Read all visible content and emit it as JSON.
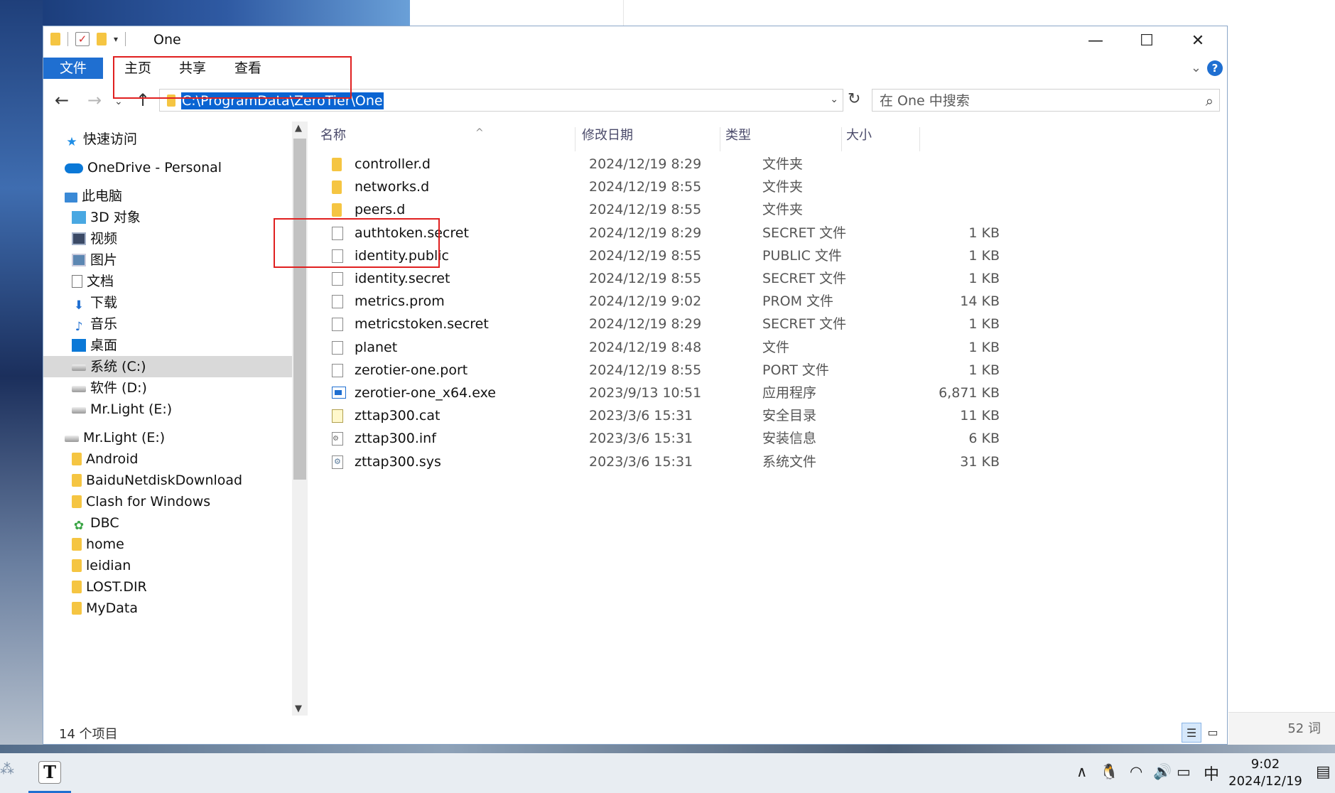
{
  "window": {
    "title": "One",
    "controls": {
      "minimize": "—",
      "maximize": "☐",
      "close": "✕"
    }
  },
  "ribbon": {
    "tabs": [
      "文件",
      "主页",
      "共享",
      "查看"
    ],
    "help": "?"
  },
  "address": {
    "path": "C:\\ProgramData\\ZeroTier\\One",
    "search_placeholder": "在 One 中搜索"
  },
  "nav_pane": {
    "items": [
      {
        "label": "快速访问",
        "icon": "star-icon"
      },
      {
        "label": "OneDrive - Personal",
        "icon": "cloud-icon"
      },
      {
        "label": "此电脑",
        "icon": "pc-icon"
      },
      {
        "label": "3D 对象",
        "icon": "3d-objects-icon"
      },
      {
        "label": "视频",
        "icon": "video-icon"
      },
      {
        "label": "图片",
        "icon": "picture-icon"
      },
      {
        "label": "文档",
        "icon": "document-icon"
      },
      {
        "label": "下载",
        "icon": "download-icon"
      },
      {
        "label": "音乐",
        "icon": "music-icon"
      },
      {
        "label": "桌面",
        "icon": "desktop-icon"
      },
      {
        "label": "系统 (C:)",
        "icon": "drive-icon",
        "selected": true
      },
      {
        "label": "软件 (D:)",
        "icon": "drive-icon"
      },
      {
        "label": "Mr.Light (E:)",
        "icon": "drive-icon"
      },
      {
        "label": "Mr.Light (E:)",
        "icon": "drive-icon"
      },
      {
        "label": "Android",
        "icon": "folder-icon"
      },
      {
        "label": "BaiduNetdiskDownload",
        "icon": "folder-icon"
      },
      {
        "label": "Clash for Windows",
        "icon": "folder-icon"
      },
      {
        "label": "DBC",
        "icon": "dbc-icon"
      },
      {
        "label": "home",
        "icon": "folder-icon"
      },
      {
        "label": "leidian",
        "icon": "folder-icon"
      },
      {
        "label": "LOST.DIR",
        "icon": "folder-icon"
      },
      {
        "label": "MyData",
        "icon": "folder-icon"
      }
    ]
  },
  "file_list": {
    "columns": [
      "名称",
      "修改日期",
      "类型",
      "大小"
    ],
    "rows": [
      {
        "name": "controller.d",
        "date": "2024/12/19 8:29",
        "type": "文件夹",
        "size": "",
        "icon": "folder-icon"
      },
      {
        "name": "networks.d",
        "date": "2024/12/19 8:55",
        "type": "文件夹",
        "size": "",
        "icon": "folder-icon"
      },
      {
        "name": "peers.d",
        "date": "2024/12/19 8:55",
        "type": "文件夹",
        "size": "",
        "icon": "folder-icon"
      },
      {
        "name": "authtoken.secret",
        "date": "2024/12/19 8:29",
        "type": "SECRET 文件",
        "size": "1 KB",
        "icon": "file-icon"
      },
      {
        "name": "identity.public",
        "date": "2024/12/19 8:55",
        "type": "PUBLIC 文件",
        "size": "1 KB",
        "icon": "file-icon"
      },
      {
        "name": "identity.secret",
        "date": "2024/12/19 8:55",
        "type": "SECRET 文件",
        "size": "1 KB",
        "icon": "file-icon"
      },
      {
        "name": "metrics.prom",
        "date": "2024/12/19 9:02",
        "type": "PROM 文件",
        "size": "14 KB",
        "icon": "file-icon"
      },
      {
        "name": "metricstoken.secret",
        "date": "2024/12/19 8:29",
        "type": "SECRET 文件",
        "size": "1 KB",
        "icon": "file-icon"
      },
      {
        "name": "planet",
        "date": "2024/12/19 8:48",
        "type": "文件",
        "size": "1 KB",
        "icon": "file-icon"
      },
      {
        "name": "zerotier-one.port",
        "date": "2024/12/19 8:55",
        "type": "PORT 文件",
        "size": "1 KB",
        "icon": "file-icon"
      },
      {
        "name": "zerotier-one_x64.exe",
        "date": "2023/9/13 10:51",
        "type": "应用程序",
        "size": "6,871 KB",
        "icon": "exe-icon"
      },
      {
        "name": "zttap300.cat",
        "date": "2023/3/6 15:31",
        "type": "安全目录",
        "size": "11 KB",
        "icon": "catalog-icon"
      },
      {
        "name": "zttap300.inf",
        "date": "2023/3/6 15:31",
        "type": "安装信息",
        "size": "6 KB",
        "icon": "setup-info-icon"
      },
      {
        "name": "zttap300.sys",
        "date": "2023/3/6 15:31",
        "type": "系统文件",
        "size": "31 KB",
        "icon": "system-file-icon"
      }
    ]
  },
  "status": {
    "item_count": "14 个项目"
  },
  "background_app": {
    "word_count": "52 词"
  },
  "taskbar": {
    "app_glyph": "T",
    "ime": "中",
    "time": "9:02",
    "date": "2024/12/19"
  },
  "colors": {
    "accent": "#1f6fd1",
    "selection": "#0a64d2",
    "annotation_red": "#e02020"
  }
}
